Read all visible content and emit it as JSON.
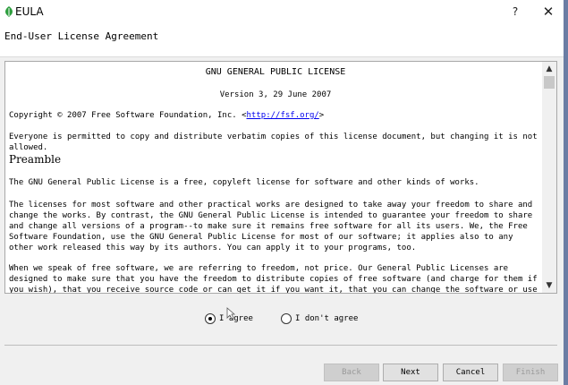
{
  "window": {
    "title": "EULA",
    "help_label": "?",
    "close_label": "✕"
  },
  "header": {
    "title": "End-User License Agreement"
  },
  "license": {
    "title": "GNU GENERAL PUBLIC LICENSE",
    "version": "Version 3, 29 June 2007",
    "copyright_prefix": "Copyright © 2007 Free Software Foundation, Inc. <",
    "copyright_link": "http://fsf.org/",
    "copyright_suffix": ">",
    "everyone": "Everyone is permitted to copy and distribute verbatim copies of this license document, but changing it is not allowed.",
    "preamble_heading": "Preamble",
    "p1": "The GNU General Public License is a free, copyleft license for software and other kinds of works.",
    "p2": "The licenses for most software and other practical works are designed to take away your freedom to share and change the works. By contrast, the GNU General Public License is intended to guarantee your freedom to share and change all versions of a program--to make sure it remains free software for all its users. We, the Free Software Foundation, use the GNU General Public License for most of our software; it applies also to any other work released this way by its authors. You can apply it to your programs, too.",
    "p3": "When we speak of free software, we are referring to freedom, not price. Our General Public Licenses are designed to make sure that you have the freedom to distribute copies of free software (and charge for them if you wish), that you receive source code or can get it if you want it, that you can change the software or use pieces of it in new free"
  },
  "scrollbar": {
    "up_glyph": "▲",
    "down_glyph": "▼"
  },
  "options": {
    "agree": {
      "label": "I agree",
      "selected": true
    },
    "disagree": {
      "label": "I don't agree",
      "selected": false
    }
  },
  "buttons": {
    "back": "Back",
    "next": "Next",
    "cancel": "Cancel",
    "finish": "Finish"
  },
  "colors": {
    "link": "#0000ee",
    "app_icon": "#2e9e3e"
  }
}
